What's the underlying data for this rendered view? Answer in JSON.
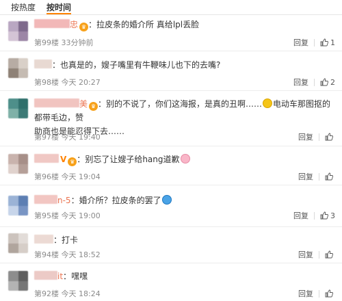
{
  "sort_tabs": [
    {
      "label": "按热度"
    },
    {
      "label": "按时间"
    }
  ],
  "comments": [
    {
      "user_suffix": "忠",
      "text": "拉皮条的婚介所 真给lpl丢脸",
      "floor": "第99楼",
      "time": "33分钟前",
      "reply": "回复",
      "likes": "1"
    },
    {
      "user_suffix": "",
      "text": "也真是的，嫂子嘴里有牛鞭味儿也下的去嘴?",
      "floor": "第98楼",
      "time": "今天 20:27",
      "reply": "回复",
      "likes": "2"
    },
    {
      "user_suffix": "美",
      "text_a": "别的不说了，你们这海报，是真的丑啊……",
      "text_b": "电动车那图抠的都带毛边，赞",
      "text_c": "助商也是能忍得下去……",
      "floor": "第97楼",
      "time": "今天 19:40",
      "reply": "回复",
      "likes": ""
    },
    {
      "user_suffix": "V",
      "text": "别忘了让嫂子给hang道歉",
      "floor": "第96楼",
      "time": "今天 19:04",
      "reply": "回复",
      "likes": ""
    },
    {
      "user_suffix": "n-5",
      "text": "婚介所？拉皮条的罢了",
      "floor": "第95楼",
      "time": "今天 19:00",
      "reply": "回复",
      "likes": "3"
    },
    {
      "user_suffix": "",
      "text": "打卡",
      "floor": "第94楼",
      "time": "今天 18:52",
      "reply": "回复",
      "likes": ""
    },
    {
      "user_suffix": "it",
      "text": "嘿嘿",
      "floor": "第92楼",
      "time": "今天 18:24",
      "reply": "回复",
      "likes": ""
    }
  ],
  "colors": {
    "accent": "#ff8200",
    "meta_text": "#8a8a8a",
    "divider": "#ececec"
  },
  "icons": {
    "like": "thumbs-up-icon",
    "badge": "fan-badge-icon"
  }
}
